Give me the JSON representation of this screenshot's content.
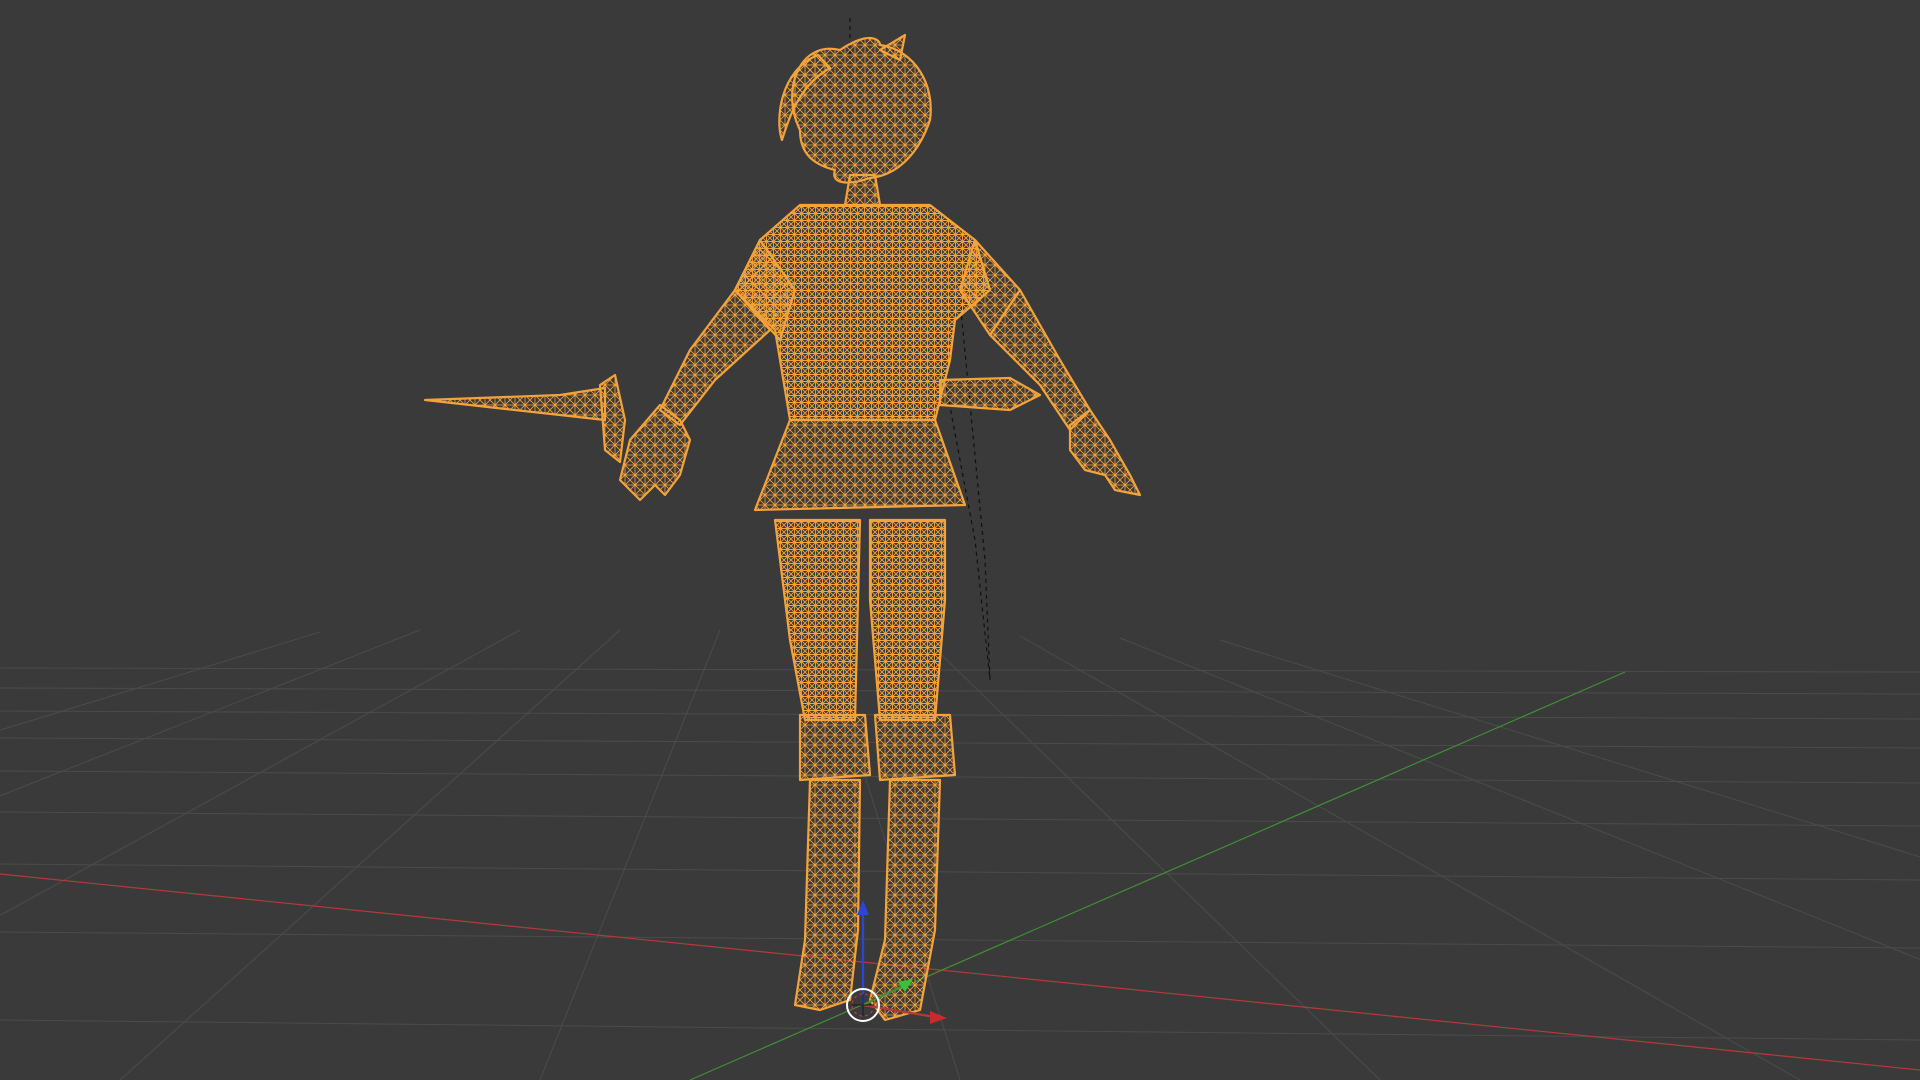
{
  "viewport": {
    "view": "3d-viewport",
    "shading": "wireframe",
    "background_color": "#3a3a3a",
    "grid_color": "#4d4d4d",
    "selection_color": "#f4a23a",
    "x_axis_color": "#b33a3a",
    "y_axis_color": "#3e8f35",
    "z_axis_color": "#2a45d8"
  },
  "scene": {
    "selected_object": "character-mesh",
    "object_parts": [
      "hair",
      "head",
      "torso",
      "skirt",
      "arms",
      "hands",
      "dagger",
      "legs",
      "boots"
    ],
    "gizmo": {
      "icon": "transform-gizmo-icon",
      "axes": [
        "x",
        "y",
        "z"
      ]
    },
    "light": {
      "icon": "light-cone-icon"
    }
  }
}
